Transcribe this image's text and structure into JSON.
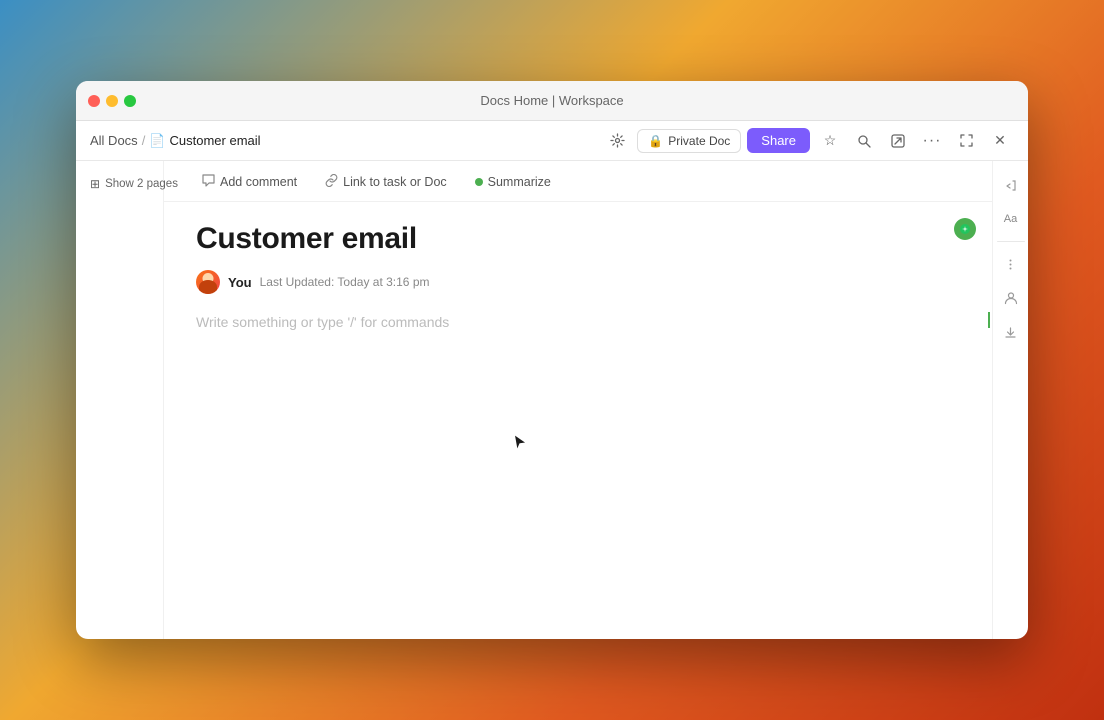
{
  "window": {
    "title": "Docs Home | Workspace"
  },
  "titlebar": {
    "title": "Docs Home | Workspace"
  },
  "breadcrumb": {
    "all_docs": "All Docs",
    "separator": "/",
    "current": "Customer email"
  },
  "navbar": {
    "private_doc_label": "Private Doc",
    "share_label": "Share"
  },
  "sidebar": {
    "show_pages_label": "Show 2 pages"
  },
  "toolbar": {
    "add_comment": "Add comment",
    "link_to_task": "Link to task or Doc",
    "summarize": "Summarize"
  },
  "document": {
    "title": "Customer email",
    "author": "You",
    "last_updated": "Last Updated: Today at 3:16 pm",
    "placeholder": "Write something or type '/' for commands"
  },
  "icons": {
    "close": "●",
    "minimize": "●",
    "maximize": "●",
    "doc": "📄",
    "lock": "🔒",
    "star": "☆",
    "search": "⌕",
    "export": "↗",
    "more": "···",
    "fullscreen_exit": "⤢",
    "close_window": "✕",
    "comment": "💬",
    "link": "🔗",
    "ai": "✦",
    "pages": "⊞",
    "font": "Aa",
    "collapse": "⇤",
    "members": "👤",
    "download": "↓"
  }
}
